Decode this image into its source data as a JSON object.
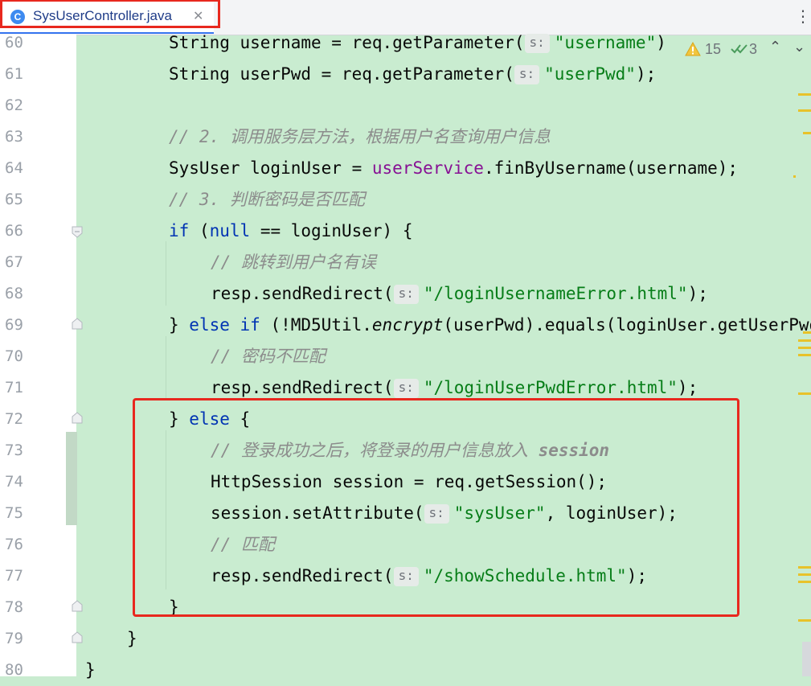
{
  "tab": {
    "icon_letter": "C",
    "label": "SysUserController.java",
    "close_glyph": "✕"
  },
  "more_menu": "⋮",
  "inspections": {
    "warnings": "15",
    "passed": "3",
    "up": "⌃",
    "down": "⌄"
  },
  "hint": "s:",
  "lines": {
    "l60": "60",
    "l61": "61",
    "l62": "62",
    "l63": "63",
    "l64": "64",
    "l65": "65",
    "l66": "66",
    "l67": "67",
    "l68": "68",
    "l69": "69",
    "l70": "70",
    "l71": "71",
    "l72": "72",
    "l73": "73",
    "l74": "74",
    "l75": "75",
    "l76": "76",
    "l77": "77",
    "l78": "78",
    "l79": "79",
    "l80": "80"
  },
  "code": {
    "l60": {
      "a": "String username = req.getParameter(",
      "s": "\"username\"",
      "b": ")"
    },
    "l61": {
      "a": "String userPwd = req.getParameter(",
      "s": "\"userPwd\"",
      "b": ");"
    },
    "l63": {
      "c": "// 2. 调用服务层方法，根据用户名查询用户信息"
    },
    "l64": {
      "a": "SysUser loginUser = ",
      "f": "userService",
      "b": ".finByUsername(username);"
    },
    "l65": {
      "c": "// 3. 判断密码是否匹配"
    },
    "l66": {
      "k1": "if",
      "a": " (",
      "k2": "null",
      "b": " == loginUser) {"
    },
    "l67": {
      "c": "// 跳转到用户名有误"
    },
    "l68": {
      "a": "resp.sendRedirect(",
      "s": "\"/loginUsernameError.html\"",
      "b": ");"
    },
    "l69": {
      "a": "} ",
      "k1": "else",
      "k2": "if",
      "b": " (!MD5Util.",
      "i": "encrypt",
      "d": "(userPwd).equals(loginUser.getUserPwd"
    },
    "l70": {
      "c": "// 密码不匹配"
    },
    "l71": {
      "a": "resp.sendRedirect(",
      "s": "\"/loginUserPwdError.html\"",
      "b": ");"
    },
    "l72": {
      "a": "} ",
      "k1": "else",
      "b": " {"
    },
    "l73": {
      "c": "// 登录成功之后，将登录的用户信息放入 ",
      "cb": "session"
    },
    "l74": {
      "a": "HttpSession session = req.getSession();"
    },
    "l75": {
      "a": "session.setAttribute(",
      "s": "\"sysUser\"",
      "b": ", loginUser);"
    },
    "l76": {
      "c": "// 匹配"
    },
    "l77": {
      "a": "resp.sendRedirect(",
      "s": "\"/showSchedule.html\"",
      "b": ");"
    },
    "l78": {
      "a": "}"
    },
    "l79": {
      "a": "}"
    },
    "l80": {
      "a": "}"
    }
  }
}
